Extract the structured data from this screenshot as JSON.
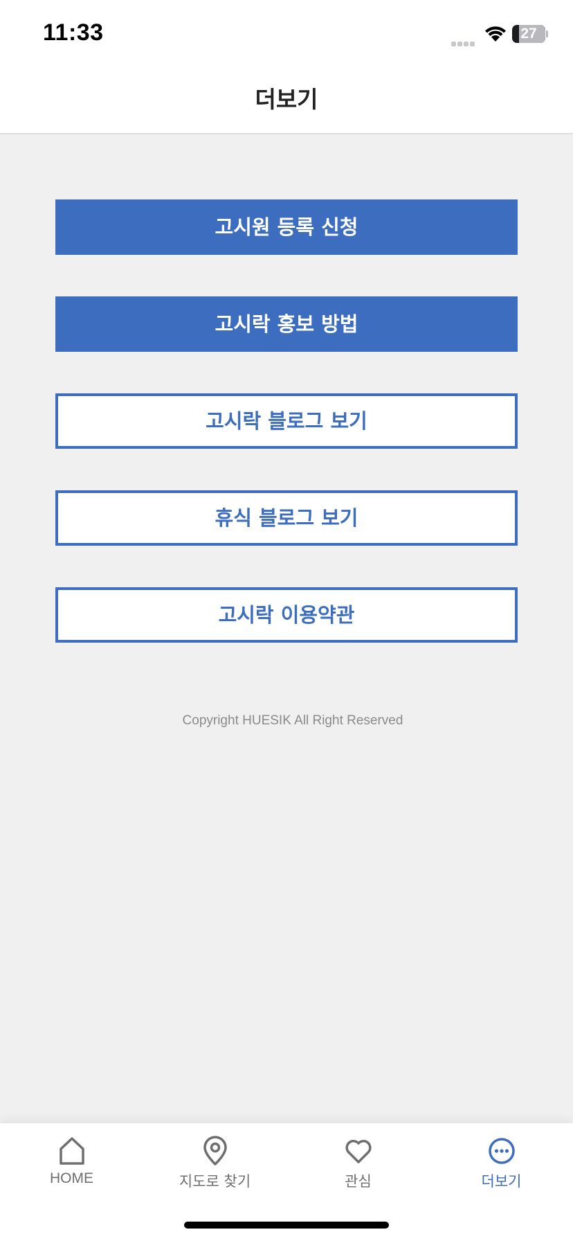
{
  "status_bar": {
    "time": "11:33",
    "battery": "27",
    "icons": [
      "signal-icon",
      "wifi-icon",
      "battery-icon"
    ]
  },
  "header": {
    "title": "더보기"
  },
  "menu": {
    "buttons": [
      {
        "label": "고시원 등록 신청",
        "style": "filled"
      },
      {
        "label": "고시락 홍보 방법",
        "style": "filled"
      },
      {
        "label": "고시락 블로그 보기",
        "style": "outlined"
      },
      {
        "label": "휴식 블로그 보기",
        "style": "outlined"
      },
      {
        "label": "고시락 이용약관",
        "style": "outlined"
      }
    ]
  },
  "footer": {
    "copyright": "Copyright HUESIK All Right Reserved"
  },
  "tab_bar": {
    "active": "더보기",
    "items": [
      {
        "label": "HOME",
        "icon": "home-icon"
      },
      {
        "label": "지도로 찾기",
        "icon": "map-pin-icon"
      },
      {
        "label": "관심",
        "icon": "heart-icon"
      },
      {
        "label": "더보기",
        "icon": "more-icon"
      }
    ]
  },
  "colors": {
    "accent": "#3d6dbe",
    "background": "#f0f0f1",
    "inactive_tab": "#6e6e6e"
  }
}
